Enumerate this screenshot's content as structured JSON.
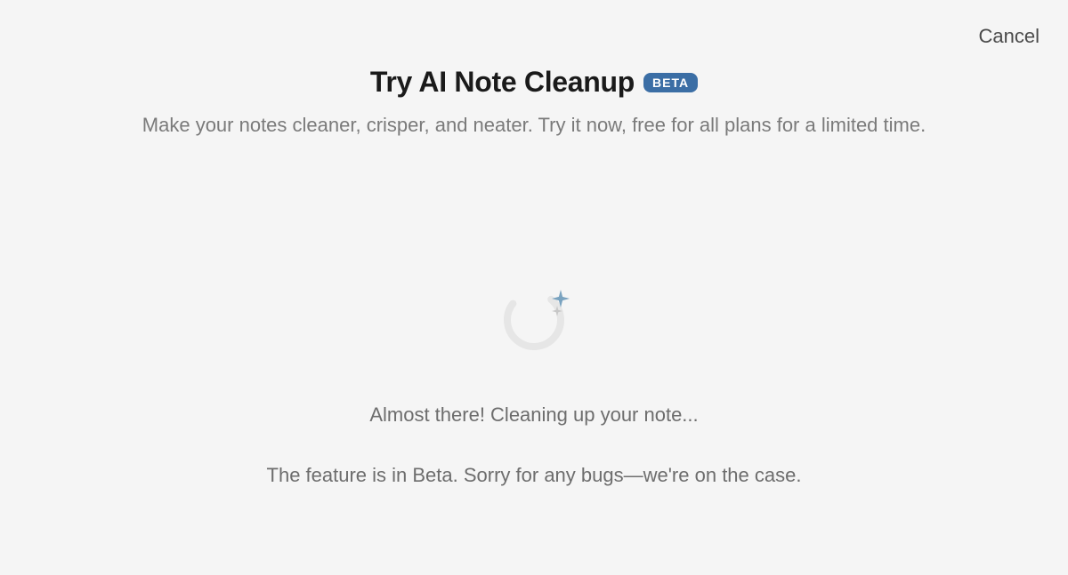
{
  "cancel_label": "Cancel",
  "header": {
    "title": "Try AI Note Cleanup",
    "badge": "BETA",
    "subtitle": "Make your notes cleaner, crisper, and neater. Try it now, free for all plans for a limited time."
  },
  "loading": {
    "status": "Almost there! Cleaning up your note...",
    "disclaimer": "The feature is in Beta. Sorry for any bugs—we're on the case."
  },
  "colors": {
    "badge_bg": "#3b6ea5",
    "sparkle_blue": "#6699bb",
    "sparkle_gray": "#c7c7c7",
    "ring": "#e6e6e6"
  }
}
